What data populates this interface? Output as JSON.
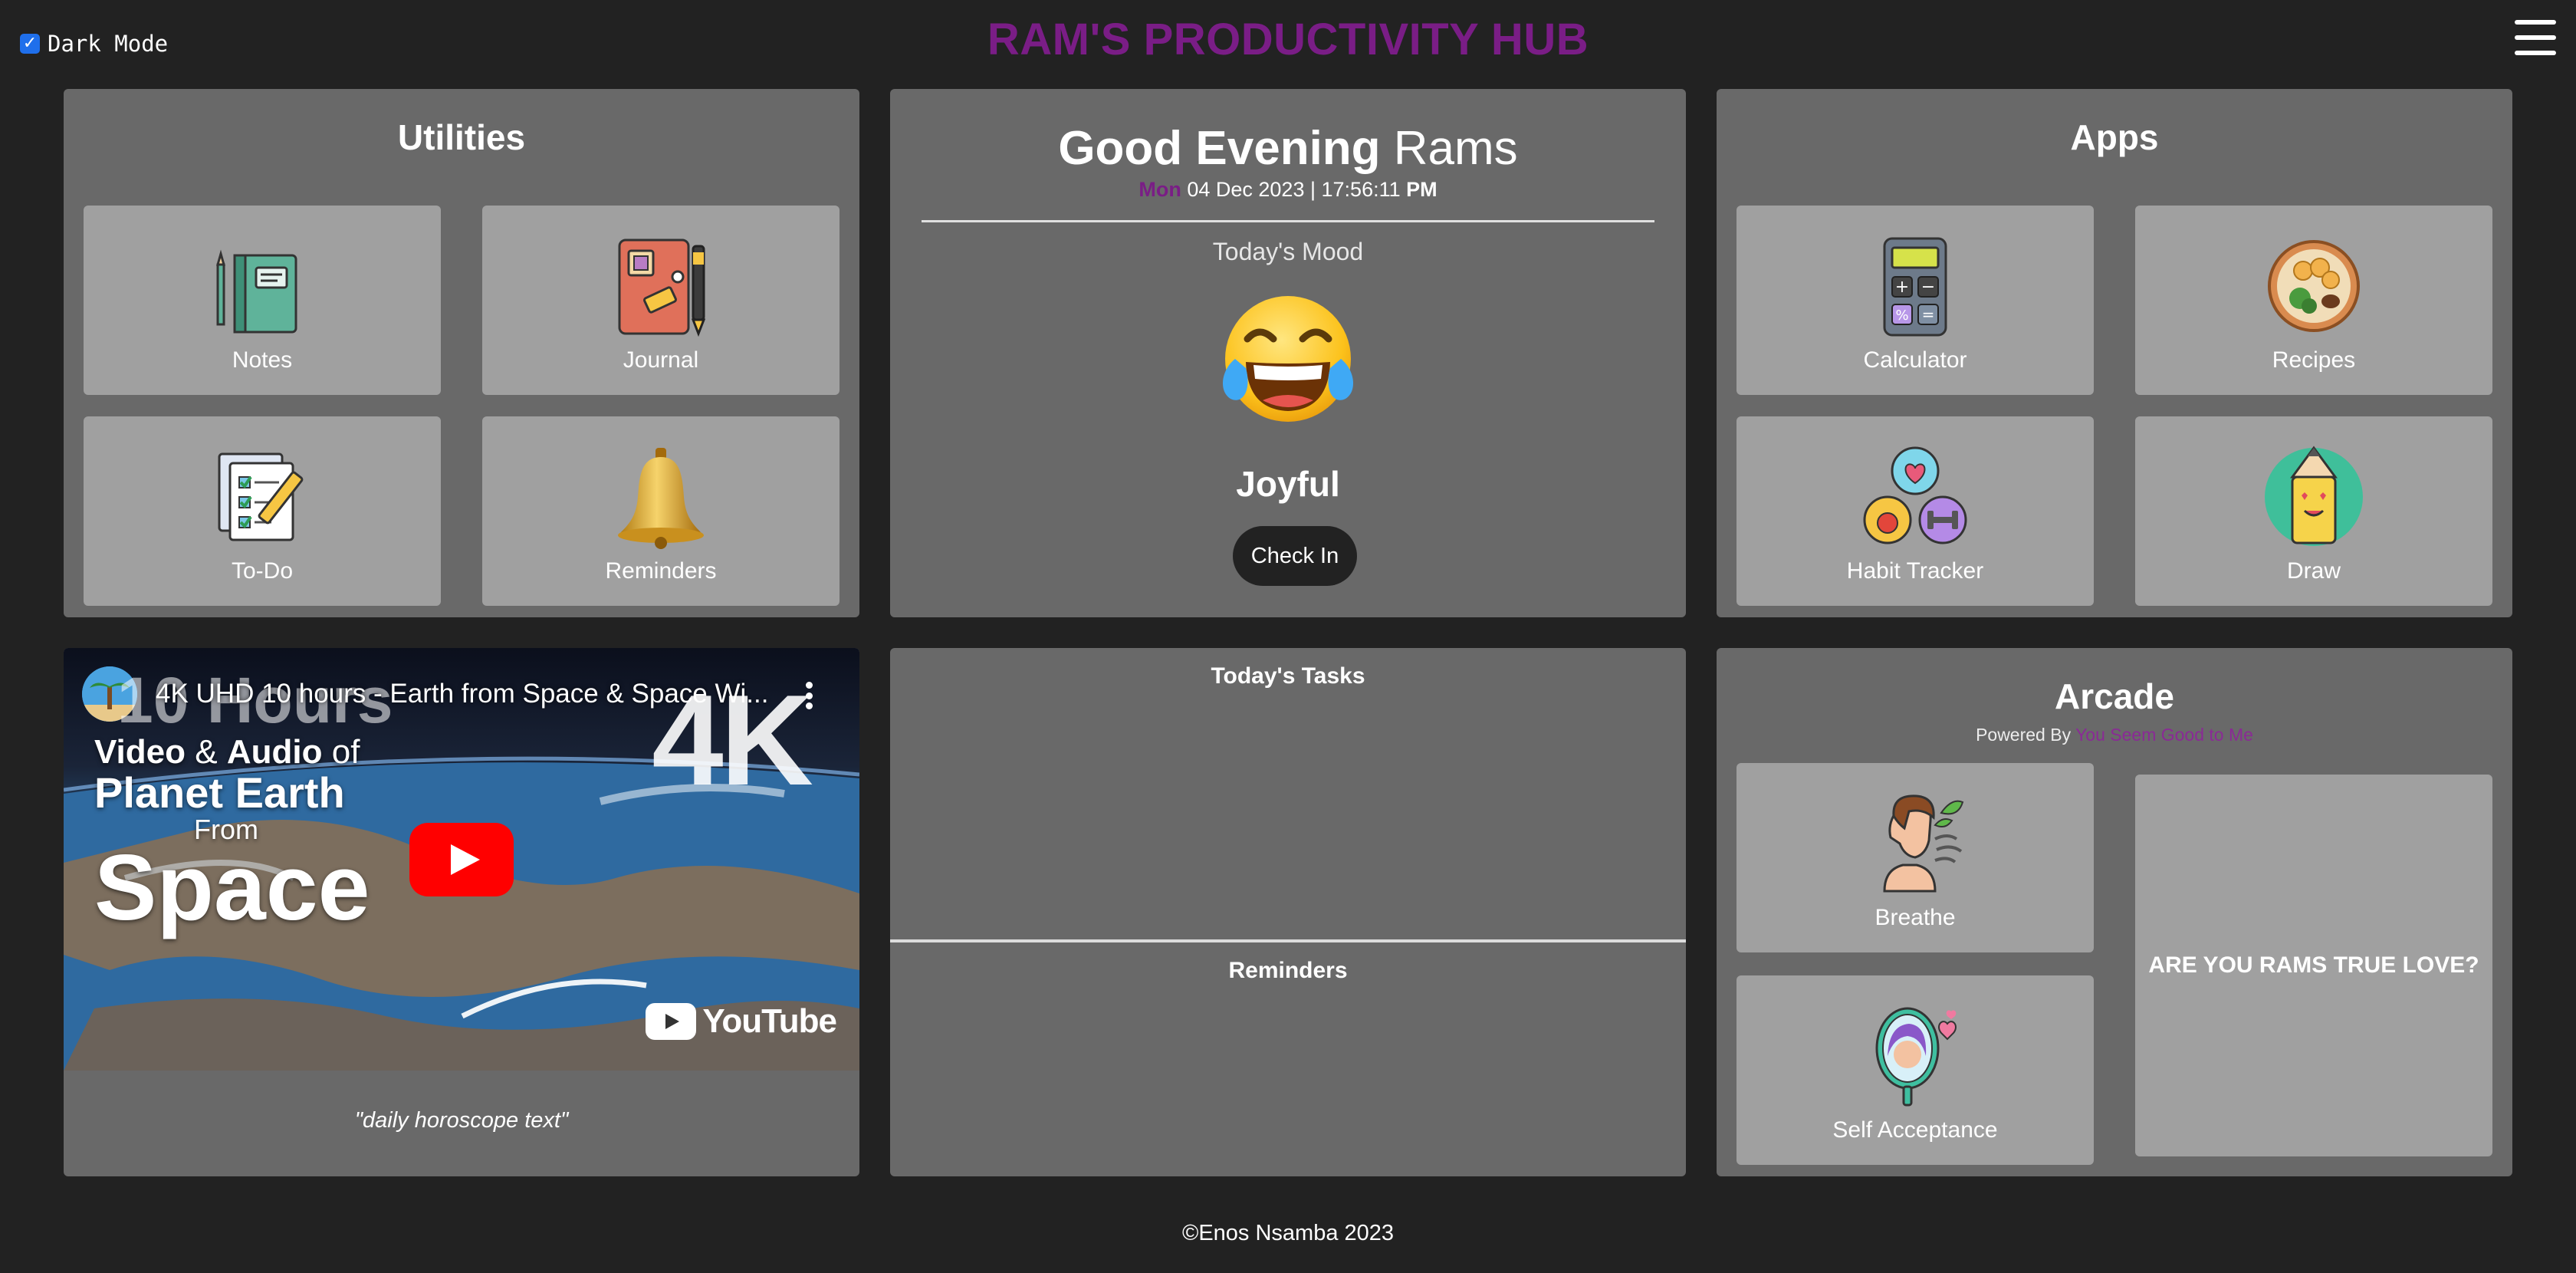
{
  "header": {
    "dark_mode_label": "Dark Mode",
    "dark_mode_checked": true,
    "title": "RAM'S PRODUCTIVITY HUB",
    "title_color": "#7a1d86",
    "menu_icon": "hamburger-menu-icon"
  },
  "utilities": {
    "title": "Utilities",
    "items": [
      {
        "label": "Notes",
        "icon": "notebook-icon"
      },
      {
        "label": "Journal",
        "icon": "journal-icon"
      },
      {
        "label": "To-Do",
        "icon": "checklist-icon"
      },
      {
        "label": "Reminders",
        "icon": "bell-icon"
      }
    ]
  },
  "greeting": {
    "salutation": "Good Evening",
    "name": "Rams",
    "day": "Mon",
    "date": "04 Dec 2023",
    "separator": "|",
    "time": "17:56:11",
    "ampm": "PM",
    "mood_title": "Today's Mood",
    "mood_icon": "tears-of-joy-emoji",
    "mood_label": "Joyful",
    "checkin_label": "Check In"
  },
  "apps": {
    "title": "Apps",
    "items": [
      {
        "label": "Calculator",
        "icon": "calculator-icon"
      },
      {
        "label": "Recipes",
        "icon": "food-bowl-icon"
      },
      {
        "label": "Habit Tracker",
        "icon": "habit-icon"
      },
      {
        "label": "Draw",
        "icon": "pencil-face-icon"
      }
    ]
  },
  "video": {
    "title": "4K UHD 10 hours - Earth from Space & Space Wi...",
    "overlay_big": "10 Hours",
    "badge": "4K",
    "line1_bold": "Video",
    "line1_amp": "&",
    "line1_bold2": "Audio",
    "line1_of": "of",
    "line2": "Planet Earth",
    "line3": "From",
    "line4": "Space",
    "brand": "YouTube",
    "horoscope": "\"daily horoscope text\""
  },
  "tasks": {
    "tasks_title": "Today's Tasks",
    "reminders_title": "Reminders"
  },
  "arcade": {
    "title": "Arcade",
    "powered_prefix": "Powered By",
    "powered_link": "You Seem Good to Me",
    "items": [
      {
        "label": "Breathe",
        "icon": "breathe-icon"
      },
      {
        "label": "Self Acceptance",
        "icon": "mirror-icon"
      }
    ],
    "love_text": "ARE YOU RAMS TRUE LOVE?"
  },
  "footer": {
    "text": "©Enos Nsamba 2023"
  }
}
